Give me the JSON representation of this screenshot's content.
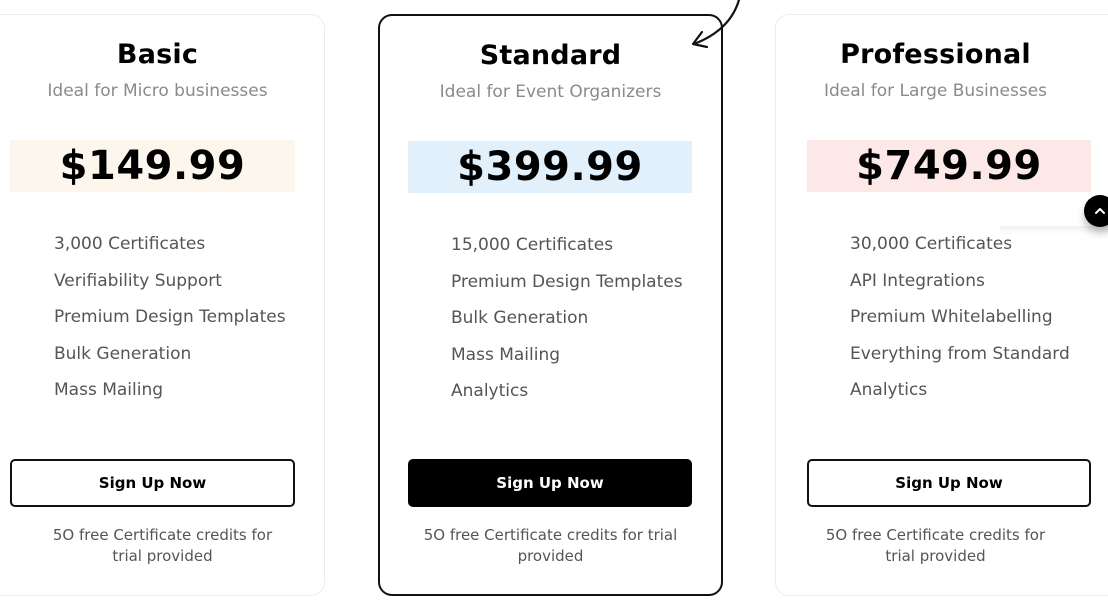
{
  "plans": [
    {
      "name": "Basic",
      "subtitle": "Ideal for Micro businesses",
      "price": "$149.99",
      "price_bg": "#fdf6ec",
      "features": [
        "3,000 Certificates",
        "Verifiability Support",
        "Premium Design Templates",
        "Bulk Generation",
        "Mass Mailing"
      ],
      "cta": "Sign Up Now",
      "note": "5O free Certificate credits for trial provided"
    },
    {
      "name": "Standard",
      "subtitle": "Ideal for Event Organizers",
      "price": "$399.99",
      "price_bg": "#e1f0fa",
      "features": [
        "15,000 Certificates",
        "Premium Design Templates",
        "Bulk Generation",
        "Mass Mailing",
        "Analytics"
      ],
      "cta": "Sign Up Now",
      "note": "5O free Certificate credits for trial provided",
      "featured": true
    },
    {
      "name": "Professional",
      "subtitle": "Ideal for Large Businesses",
      "price": "$749.99",
      "price_bg": "#fde8e8",
      "features": [
        "30,000 Certificates",
        "API Integrations",
        "Premium Whitelabelling",
        "Everything from Standard",
        "Analytics"
      ],
      "cta": "Sign Up Now",
      "note": "5O free Certificate credits for trial provided"
    }
  ],
  "icons": {
    "scroll_top": "chevron-up-icon",
    "arrow": "curved-arrow-icon"
  }
}
